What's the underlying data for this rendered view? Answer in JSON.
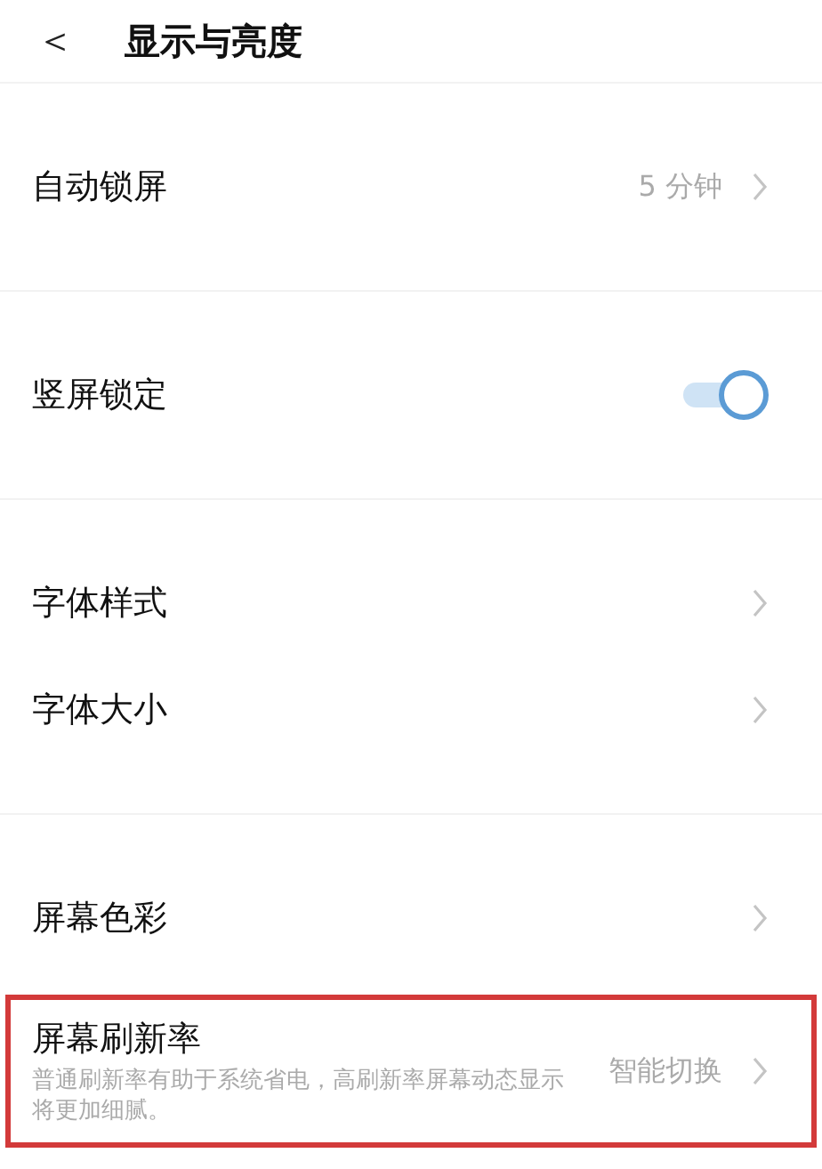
{
  "header": {
    "back": "＜",
    "title": "显示与亮度"
  },
  "sections": [
    {
      "items": [
        {
          "kind": "link",
          "label": "自动锁屏",
          "value": "5 分钟",
          "highlighted": false
        }
      ]
    },
    {
      "items": [
        {
          "kind": "switch",
          "label": "竖屏锁定",
          "on": true,
          "highlighted": false
        }
      ]
    },
    {
      "items": [
        {
          "kind": "link",
          "label": "字体样式",
          "highlighted": false
        },
        {
          "kind": "link",
          "label": "字体大小",
          "highlighted": false
        }
      ]
    },
    {
      "items": [
        {
          "kind": "link",
          "label": "屏幕色彩",
          "highlighted": false
        },
        {
          "kind": "link",
          "label": "屏幕刷新率",
          "description": "普通刷新率有助于系统省电，高刷新率屏幕动态显示将更加细腻。",
          "value": "智能切换",
          "highlighted": true
        }
      ]
    }
  ]
}
